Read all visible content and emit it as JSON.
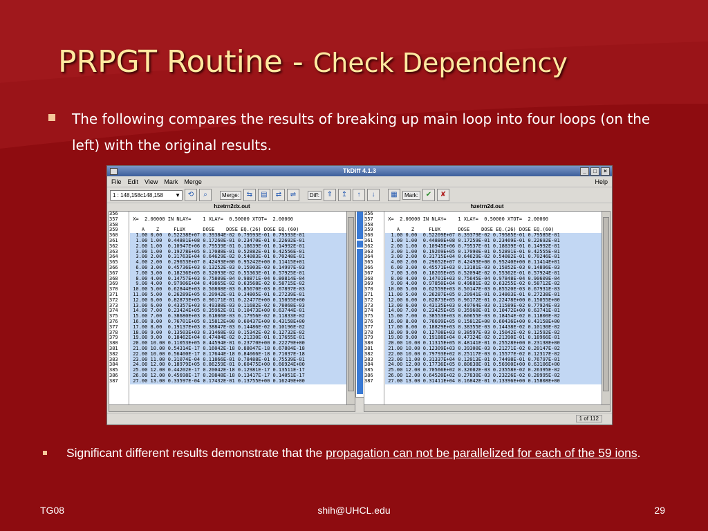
{
  "slide": {
    "title_main": "PRPGT Routine - ",
    "title_sub": "Check Dependency",
    "bullet1": "The following compares the results of breaking up main loop into four loops (on the left) with the original results.",
    "bullet2_prefix": "Significant different results demonstrate that the ",
    "bullet2_link": "propagation can not be parallelized for  each of the 59 ions",
    "bullet2_suffix": ".",
    "footer_left": "TG08",
    "footer_center": "shih@UHCL.edu",
    "footer_right": "29"
  },
  "window": {
    "title": "TkDiff 4.1.3",
    "menu": [
      "File",
      "Edit",
      "View",
      "Mark",
      "Merge"
    ],
    "help": "Help",
    "combo_value": "1    : 148,158c148,158",
    "merge_label": "Merge:",
    "diff_label": "Diff:",
    "mark_label": "Mark:",
    "left_file": "hzetrn2dx.out",
    "right_file": "hzetrn2d.out",
    "status": "1 of 112",
    "line_numbers": [
      "356",
      "357",
      "358",
      "359",
      "360",
      "361",
      "362",
      "363",
      "364",
      "365",
      "366",
      "367",
      "368",
      "369",
      "370",
      "371",
      "372",
      "373",
      "374",
      "375",
      "376",
      "377",
      "378",
      "379",
      "380",
      "381",
      "382",
      "383",
      "384",
      "385",
      "386",
      "387"
    ],
    "header_line": " X=  2.00000 IN NLAY=    1 XLAY=  0.50000 XTOT=  2.00000",
    "col_header": "    A    Z     FLUX      DOSE    DOSE EQ.(26) DOSE EQ.(60)",
    "left_rows": [
      "  1.00 0.00  0.52238E+07 0.39384E-02 0.79593E-01 0.79593E-01",
      "  1.00 1.00  0.44881E+08 0.17260E-01 0.23470E-01 0.22692E-01",
      "  2.00 1.00  0.10947E+06 0.79539E-01 0.18639E-01 0.14992E-01",
      "  3.00 1.00  0.19278E+05 0.17088E-01 0.52882E-01 0.42556E-01",
      "  3.00 2.00  0.31763E+04 0.64629E-02 0.54083E-01 0.70248E-01",
      "  4.00 2.00  0.29653E+07 0.42493E+00 0.95242E+00 0.11415E+01",
      "  6.00 3.00  0.45736E+03 0.13252E-03 0.15903E-03 0.14997E-03",
      "  7.00 3.00  0.18236E+05 0.52093E-02 0.55363E-01 0.57925E-01",
      "  8.00 4.00  0.14757E+03 0.75809E-04 0.98871E-04 0.80814E-04",
      "  9.00 4.00  0.97906E+04 0.49865E-02 0.63568E-02 0.58715E-02",
      " 10.00 5.00  0.62844E+03 0.50808E-03 0.85670E-03 0.67897E-03",
      " 11.00 5.00  0.26289E+05 0.20942E-01 0.34805E-01 0.27239E-01",
      " 12.00 6.00  0.82873E+05 0.96171E-01 0.22477E+00 0.15055E+00",
      " 13.00 6.00  0.43357E+03 0.49388E-03 0.11682E-02 0.78068E-03",
      " 14.00 7.00  0.23424E+05 0.35962E-01 0.10473E+00 0.63744E-01",
      " 15.00 7.00  0.38680E+03 0.61806E-03 0.17956E-02 0.11833E-02",
      " 16.00 8.00  0.76701E+05 0.15812E+00 0.60437E+00 0.43158E+00",
      " 17.00 8.00  0.19137E+03 0.38847E-03 0.14486E-02 0.10196E-02",
      " 18.00 9.00  0.13503E+03 0.31468E-03 0.15342E-02 0.12732E-02",
      " 19.00 9.00  0.18462E+04 0.47484E-02 0.21330E-01 0.17655E-01",
      " 20.00 10.00 0.11053E+05 0.44594E-01 0.23770E+00 0.22279E+00",
      " 21.00 10.00 0.54314E-17 0.16042E-18 0.88047E-18 0.67804E-18",
      " 22.00 10.00 0.56400E-17 0.17644E-18 0.84066E-18 0.71037E-18",
      " 23.00 11.00 0.31074E-04 0.11866E-01 0.78488E-01 0.75539E-01",
      " 24.00 12.00 0.18979E+05 0.86259E-01 0.60475E+00 0.66924E+00",
      " 25.00 12.00 0.44202E-17 0.20042E-18 0.12981E-17 0.13511E-17",
      " 26.00 12.00 0.45698E-17 0.20848E-18 0.13417E-17 0.14051E-17",
      " 27.00 13.00 0.33597E-04 0.17432E-01 0.13755E+00 0.16249E+00"
    ],
    "right_rows": [
      "  1.00 0.00  0.52209E+07 0.39379E-02 0.79585E-01 0.79585E-01",
      "  1.00 1.00  0.44880E+08 0.17259E-01 0.23469E-01 0.22692E-01",
      "  2.00 1.00  0.10945E+06 0.79537E-01 0.18839E-01 0.14992E-01",
      "  3.00 1.00  0.19269E+05 0.17090E-01 0.52891E-01 0.42555E-01",
      "  3.00 2.00  0.31715E+04 0.64629E-02 0.54082E-01 0.70246E-01",
      "  4.00 2.00  0.29652E+07 0.42493E+00 0.95240E+00 0.11414E+01",
      "  6.00 3.00  0.45571E+03 0.13181E-03 0.15852E-03 0.14896E-03",
      "  7.00 3.00  0.18205E+05 0.52094E-02 0.55362E-01 0.57924E-01",
      "  8.00 4.00  0.14701E+03 0.75645E-04 0.97848E-04 0.90609E-04",
      "  9.00 4.00  0.97850E+04 0.49881E-02 0.63255E-02 0.58712E-02",
      " 10.00 5.00  0.62559E+03 0.50147E-03 0.85520E-03 0.67931E-03",
      " 11.00 5.00  0.26287E+05 0.20941E-01 0.34803E-01 0.27238E-01",
      " 12.00 6.00  0.82873E+05 0.96172E-01 0.22478E+00 0.15055E+00",
      " 13.00 6.00  0.43135E+03 0.49764E-03 0.11589E-02 0.77924E-03",
      " 14.00 7.00  0.23425E+05 0.35960E-01 0.10472E+00 0.63741E-01",
      " 15.00 7.00  0.38553E+03 0.60655E-03 0.18454E-02 0.11800E-02",
      " 16.00 8.00  0.76699E+05 0.15812E+00 0.60436E+00 0.43158E+00",
      " 17.00 8.00  0.18829E+03 0.38355E-03 0.14438E-02 0.10130E-02",
      " 18.00 9.00  0.12708E+03 0.38597E-03 0.15042E-02 0.12592E-02",
      " 19.00 9.00  0.19188E+04 0.47324E-02 0.21390E-01 0.18966E-01",
      " 20.00 10.00 0.11315E+05 0.48141E-01 0.25528E+00 0.23138E+00",
      " 21.00 10.00 0.12309E+03 0.39300E-03 0.21271E-02 0.20147E-02",
      " 22.00 10.00 0.79793E+02 0.25117E-03 0.15577E-02 0.12317E-02",
      " 23.00 11.00 0.31337E+04 0.12013E-01 0.74498E-01 0.76797E-01",
      " 24.00 12.00 0.17736E+05 0.80838E-01 0.56900E+00 0.63106E+00",
      " 25.00 12.00 0.70566E+02 0.32602E-03 0.23558E-02 0.26395E-02",
      " 26.00 12.00 0.64520E+02 0.27830E-03 0.23226E-02 0.28995E-02",
      " 27.00 13.00 0.31411E+04 0.16842E-01 0.13396E+00 0.15808E+00"
    ]
  }
}
